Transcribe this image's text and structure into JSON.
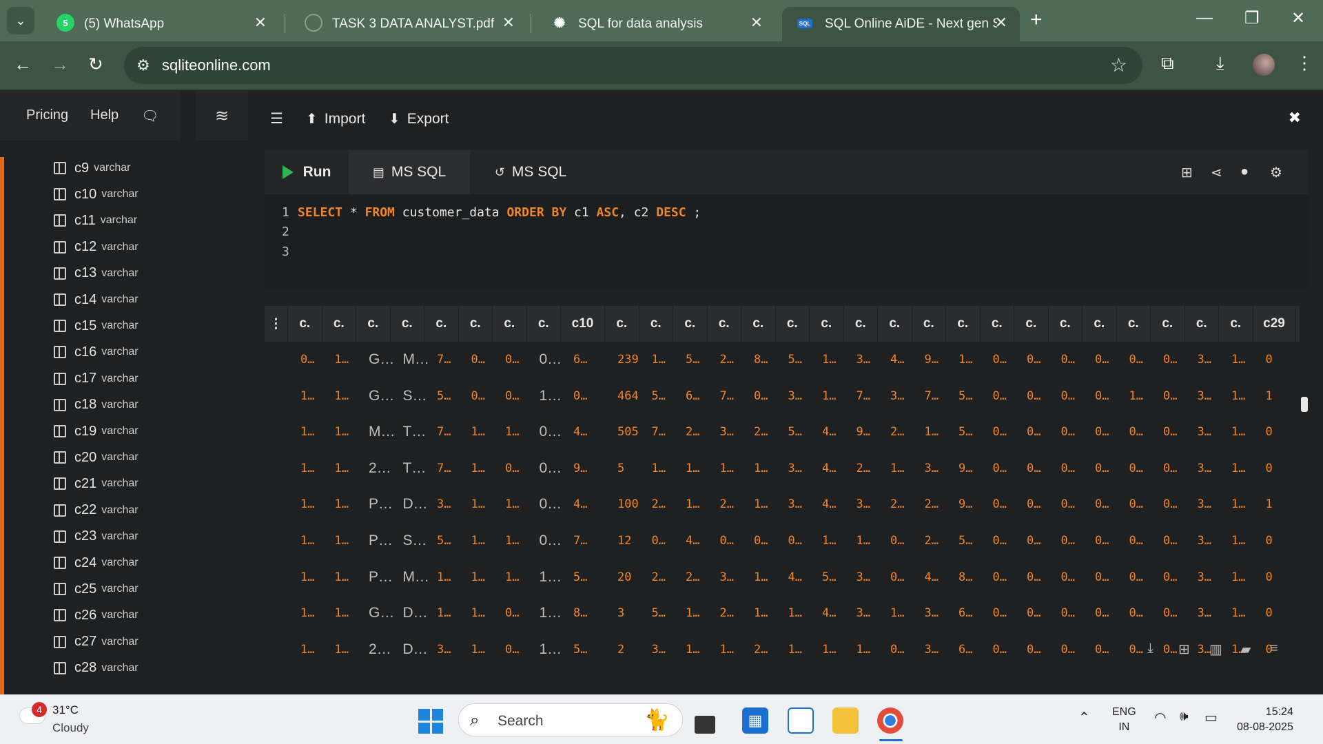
{
  "browser": {
    "tabs": [
      {
        "title": "(5) WhatsApp",
        "icon": "whatsapp-icon"
      },
      {
        "title": "TASK 3 DATA ANALYST.pdf",
        "icon": "pdf-icon"
      },
      {
        "title": "SQL for data analysis",
        "icon": "chatgpt-icon"
      },
      {
        "title": "SQL Online AiDE - Next gen SQ",
        "icon": "sqlonline-icon"
      }
    ],
    "whatsapp_badge": "5",
    "url": "sqliteonline.com"
  },
  "app": {
    "nav": {
      "pricing": "Pricing",
      "help": "Help"
    },
    "toolbar": {
      "import": "Import",
      "export": "Export"
    },
    "columns": [
      {
        "name": "c9",
        "type": "varchar"
      },
      {
        "name": "c10",
        "type": "varchar"
      },
      {
        "name": "c11",
        "type": "varchar"
      },
      {
        "name": "c12",
        "type": "varchar"
      },
      {
        "name": "c13",
        "type": "varchar"
      },
      {
        "name": "c14",
        "type": "varchar"
      },
      {
        "name": "c15",
        "type": "varchar"
      },
      {
        "name": "c16",
        "type": "varchar"
      },
      {
        "name": "c17",
        "type": "varchar"
      },
      {
        "name": "c18",
        "type": "varchar"
      },
      {
        "name": "c19",
        "type": "varchar"
      },
      {
        "name": "c20",
        "type": "varchar"
      },
      {
        "name": "c21",
        "type": "varchar"
      },
      {
        "name": "c22",
        "type": "varchar"
      },
      {
        "name": "c23",
        "type": "varchar"
      },
      {
        "name": "c24",
        "type": "varchar"
      },
      {
        "name": "c25",
        "type": "varchar"
      },
      {
        "name": "c26",
        "type": "varchar"
      },
      {
        "name": "c27",
        "type": "varchar"
      },
      {
        "name": "c28",
        "type": "varchar"
      }
    ],
    "editor": {
      "run": "Run",
      "tab1": "MS SQL",
      "tab2": "MS SQL",
      "line_numbers": [
        "1",
        "2",
        "3"
      ],
      "sql": [
        {
          "t": "SELECT",
          "k": true
        },
        {
          "t": " * ",
          "k": false
        },
        {
          "t": "FROM",
          "k": true
        },
        {
          "t": " customer_data ",
          "k": false
        },
        {
          "t": "ORDER BY",
          "k": true
        },
        {
          "t": " c1 ",
          "k": false
        },
        {
          "t": "ASC",
          "k": true
        },
        {
          "t": ", c2 ",
          "k": false
        },
        {
          "t": "DESC",
          "k": true
        },
        {
          "t": " ;",
          "k": false
        }
      ]
    },
    "grid": {
      "headers": [
        "c.",
        "c.",
        "c.",
        "c.",
        "c.",
        "c.",
        "c.",
        "c.",
        "c10",
        "c.",
        "c.",
        "c.",
        "c.",
        "c.",
        "c.",
        "c.",
        "c.",
        "c.",
        "c.",
        "c.",
        "c.",
        "c.",
        "c.",
        "c.",
        "c.",
        "c.",
        "c.",
        "c.",
        "c29"
      ],
      "rows": [
        [
          "0…",
          "1…",
          "G…",
          "M…",
          "7…",
          "0…",
          "0…",
          "0…",
          "6…",
          "239",
          "1…",
          "5…",
          "2…",
          "8…",
          "5…",
          "1…",
          "3…",
          "4…",
          "9…",
          "1…",
          "0…",
          "0…",
          "0…",
          "0…",
          "0…",
          "0…",
          "3…",
          "1…",
          "0"
        ],
        [
          "1…",
          "1…",
          "G…",
          "S…",
          "5…",
          "0…",
          "0…",
          "1…",
          "0…",
          "464",
          "5…",
          "6…",
          "7…",
          "0…",
          "3…",
          "1…",
          "7…",
          "3…",
          "7…",
          "5…",
          "0…",
          "0…",
          "0…",
          "0…",
          "1…",
          "0…",
          "3…",
          "1…",
          "1"
        ],
        [
          "1…",
          "1…",
          "M…",
          "T…",
          "7…",
          "1…",
          "1…",
          "0…",
          "4…",
          "505",
          "7…",
          "2…",
          "3…",
          "2…",
          "5…",
          "4…",
          "9…",
          "2…",
          "1…",
          "5…",
          "0…",
          "0…",
          "0…",
          "0…",
          "0…",
          "0…",
          "3…",
          "1…",
          "0"
        ],
        [
          "1…",
          "1…",
          "2…",
          "T…",
          "7…",
          "1…",
          "0…",
          "0…",
          "9…",
          "5",
          "1…",
          "1…",
          "1…",
          "1…",
          "3…",
          "4…",
          "2…",
          "1…",
          "3…",
          "9…",
          "0…",
          "0…",
          "0…",
          "0…",
          "0…",
          "0…",
          "3…",
          "1…",
          "0"
        ],
        [
          "1…",
          "1…",
          "P…",
          "D…",
          "3…",
          "1…",
          "1…",
          "0…",
          "4…",
          "100",
          "2…",
          "1…",
          "2…",
          "1…",
          "3…",
          "4…",
          "3…",
          "2…",
          "2…",
          "9…",
          "0…",
          "0…",
          "0…",
          "0…",
          "0…",
          "0…",
          "3…",
          "1…",
          "1"
        ],
        [
          "1…",
          "1…",
          "P…",
          "S…",
          "5…",
          "1…",
          "1…",
          "0…",
          "7…",
          "12",
          "0…",
          "4…",
          "0…",
          "0…",
          "0…",
          "1…",
          "1…",
          "0…",
          "2…",
          "5…",
          "0…",
          "0…",
          "0…",
          "0…",
          "0…",
          "0…",
          "3…",
          "1…",
          "0"
        ],
        [
          "1…",
          "1…",
          "P…",
          "M…",
          "1…",
          "1…",
          "1…",
          "1…",
          "5…",
          "20",
          "2…",
          "2…",
          "3…",
          "1…",
          "4…",
          "5…",
          "3…",
          "0…",
          "4…",
          "8…",
          "0…",
          "0…",
          "0…",
          "0…",
          "0…",
          "0…",
          "3…",
          "1…",
          "0"
        ],
        [
          "1…",
          "1…",
          "G…",
          "D…",
          "1…",
          "1…",
          "0…",
          "1…",
          "8…",
          "3",
          "5…",
          "1…",
          "2…",
          "1…",
          "1…",
          "4…",
          "3…",
          "1…",
          "3…",
          "6…",
          "0…",
          "0…",
          "0…",
          "0…",
          "0…",
          "0…",
          "3…",
          "1…",
          "0"
        ],
        [
          "1…",
          "1…",
          "2…",
          "D…",
          "3…",
          "1…",
          "0…",
          "1…",
          "5…",
          "2",
          "3…",
          "1…",
          "1…",
          "2…",
          "1…",
          "1…",
          "1…",
          "0…",
          "3…",
          "6…",
          "0…",
          "0…",
          "0…",
          "0…",
          "0…",
          "0…",
          "3…",
          "1…",
          "0"
        ]
      ]
    }
  },
  "taskbar": {
    "weather_badge": "4",
    "temp": "31°C",
    "condition": "Cloudy",
    "search": "Search",
    "lang1": "ENG",
    "lang2": "IN",
    "time": "15:24",
    "date": "08-08-2025"
  }
}
